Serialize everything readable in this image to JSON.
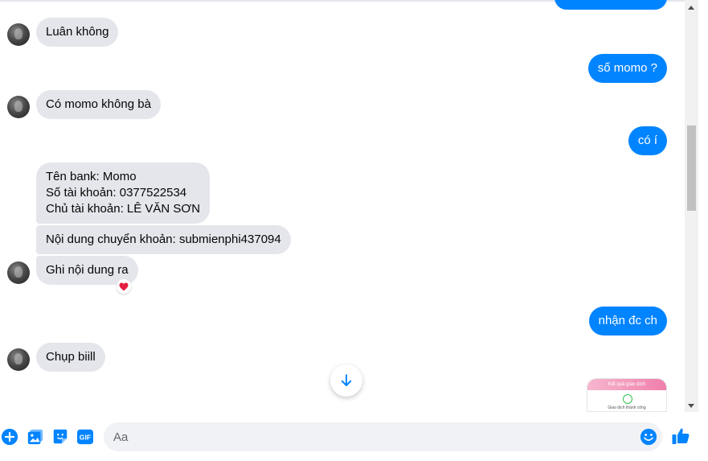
{
  "conversation": {
    "messages": [
      {
        "from": "them",
        "text": "Luân không"
      },
      {
        "from": "me",
        "text": "số momo ?"
      },
      {
        "from": "them",
        "text": "Có momo không bà"
      },
      {
        "from": "me",
        "text": "có í"
      },
      {
        "from": "them",
        "lines": [
          "Tên bank: Momo",
          "Số tài khoản: 0377522534",
          "Chủ tài khoản: LÊ VĂN SƠN"
        ]
      },
      {
        "from": "them",
        "text": "Nội dung chuyển khoản: submienphi437094"
      },
      {
        "from": "them",
        "text": "Ghi nội dung ra",
        "reaction": "heart-reaction-icon"
      },
      {
        "from": "me",
        "text": "nhận đc ch"
      },
      {
        "from": "them",
        "text": "Chụp biill"
      },
      {
        "from": "me",
        "attachment": "screenshot-thumbnail"
      }
    ],
    "thumbnail": {
      "header": "Kết quả giao dịch",
      "status": "Giao dịch thành công"
    }
  },
  "composer": {
    "placeholder": "Aa",
    "value": "",
    "icons": [
      "add-icon",
      "image-icon",
      "sticker-icon",
      "gif-icon",
      "emoji-icon",
      "like-icon"
    ],
    "gif_label": "GIF"
  },
  "colors": {
    "accent": "#0084ff",
    "incoming_bubble": "#e4e6eb",
    "heart": "#e41e3f"
  }
}
